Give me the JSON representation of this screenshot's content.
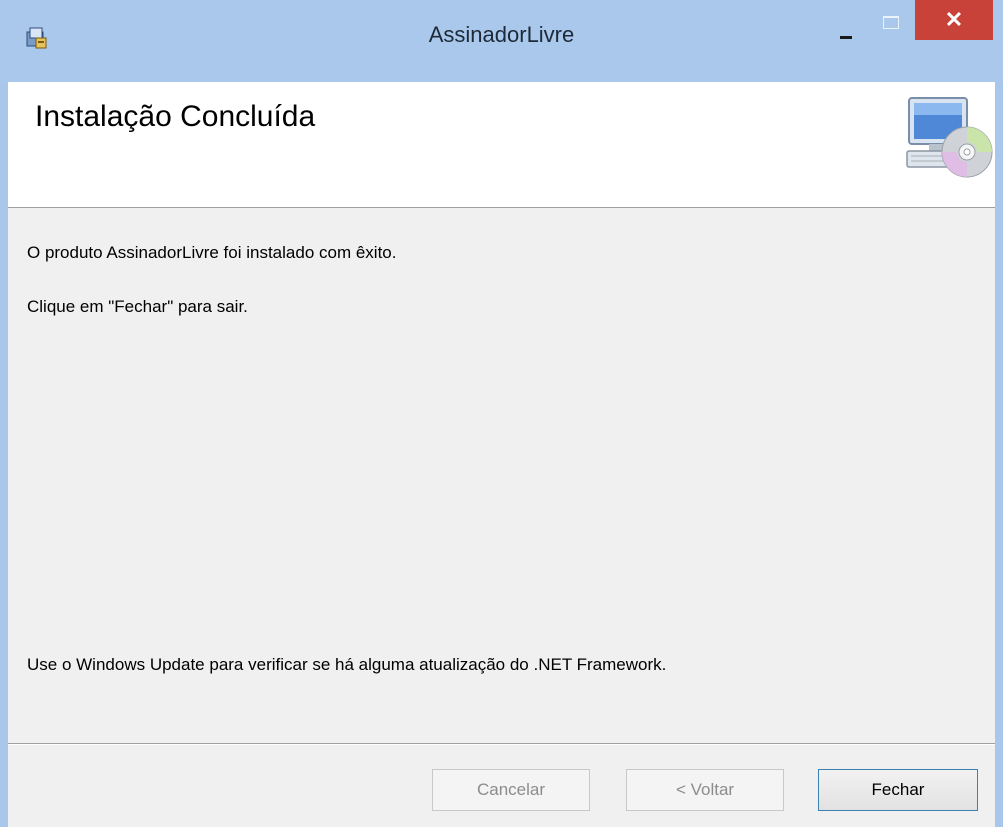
{
  "window": {
    "title": "AssinadorLivre",
    "close_glyph": "✕"
  },
  "header": {
    "heading": "Instalação Concluída"
  },
  "body": {
    "line1": "O produto AssinadorLivre foi instalado com êxito.",
    "line2": "Clique em \"Fechar\" para sair.",
    "line3": "Use o Windows Update para verificar se há alguma atualização do .NET Framework."
  },
  "buttons": {
    "cancel": "Cancelar",
    "back": "< Voltar",
    "close": "Fechar"
  },
  "colors": {
    "titlebar": "#a9c8eb",
    "close_button": "#c8423a",
    "primary_border": "#3c7fb1"
  },
  "icons": {
    "app": "installer-icon",
    "header": "computer-disc-icon"
  }
}
